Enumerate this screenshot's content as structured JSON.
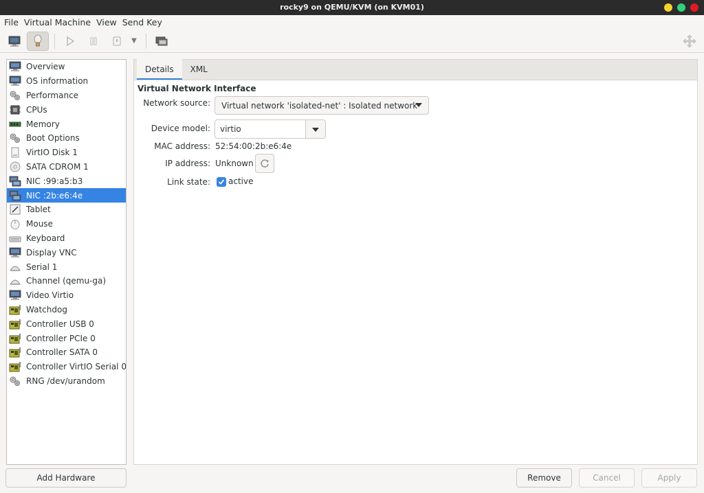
{
  "window": {
    "title": "rocky9 on QEMU/KVM (on KVM01)",
    "buttons": [
      {
        "name": "minimize",
        "color": "#f6d32d"
      },
      {
        "name": "maximize",
        "color": "#33d17a"
      },
      {
        "name": "close",
        "color": "#e01b24"
      }
    ]
  },
  "menu": [
    "File",
    "Virtual Machine",
    "View",
    "Send Key"
  ],
  "toolbar": {
    "buttons": [
      {
        "name": "console-icon",
        "active": false
      },
      {
        "name": "details-lightbulb-icon",
        "active": true
      },
      {
        "name": "run-icon",
        "active": false
      },
      {
        "name": "pause-icon",
        "active": false
      },
      {
        "name": "shutdown-icon",
        "active": false
      },
      {
        "name": "snapshots-icon",
        "active": false
      },
      {
        "name": "fullscreen-icon",
        "active": false
      }
    ]
  },
  "sidebar": {
    "items": [
      {
        "label": "Overview",
        "icon": "monitor-icon"
      },
      {
        "label": "OS information",
        "icon": "monitor-icon"
      },
      {
        "label": "Performance",
        "icon": "gears-icon"
      },
      {
        "label": "CPUs",
        "icon": "cpu-icon"
      },
      {
        "label": "Memory",
        "icon": "memory-icon"
      },
      {
        "label": "Boot Options",
        "icon": "gears-icon"
      },
      {
        "label": "VirtIO Disk 1",
        "icon": "disk-icon"
      },
      {
        "label": "SATA CDROM 1",
        "icon": "cdrom-icon"
      },
      {
        "label": "NIC :99:a5:b3",
        "icon": "network-icon"
      },
      {
        "label": "NIC :2b:e6:4e",
        "icon": "network-icon",
        "selected": true
      },
      {
        "label": "Tablet",
        "icon": "tablet-icon"
      },
      {
        "label": "Mouse",
        "icon": "mouse-icon"
      },
      {
        "label": "Keyboard",
        "icon": "keyboard-icon"
      },
      {
        "label": "Display VNC",
        "icon": "monitor-icon"
      },
      {
        "label": "Serial 1",
        "icon": "serial-icon"
      },
      {
        "label": "Channel (qemu-ga)",
        "icon": "serial-icon"
      },
      {
        "label": "Video Virtio",
        "icon": "monitor-icon"
      },
      {
        "label": "Watchdog",
        "icon": "controller-icon"
      },
      {
        "label": "Controller USB 0",
        "icon": "controller-icon"
      },
      {
        "label": "Controller PCIe 0",
        "icon": "controller-icon"
      },
      {
        "label": "Controller SATA 0",
        "icon": "controller-icon"
      },
      {
        "label": "Controller VirtIO Serial 0",
        "icon": "controller-icon"
      },
      {
        "label": "RNG /dev/urandom",
        "icon": "gears-icon"
      }
    ],
    "add_hardware": "Add Hardware"
  },
  "tabs": [
    {
      "label": "Details",
      "active": true
    },
    {
      "label": "XML",
      "active": false
    }
  ],
  "details": {
    "section_title": "Virtual Network Interface",
    "network_source_label": "Network source:",
    "network_source_value": "Virtual network 'isolated-net' : Isolated network",
    "device_model_label": "Device model:",
    "device_model_value": "virtio",
    "mac_label": "MAC address:",
    "mac_value": "52:54:00:2b:e6:4e",
    "ip_label": "IP address:",
    "ip_value": "Unknown",
    "link_state_label": "Link state:",
    "link_state_value": "active",
    "link_state_checked": true
  },
  "footer": {
    "remove": "Remove",
    "cancel": "Cancel",
    "apply": "Apply"
  },
  "colors": {
    "accent": "#3584e4",
    "titlebar": "#2b2b2b"
  }
}
